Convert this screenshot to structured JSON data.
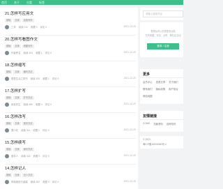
{
  "nav": [
    "首页",
    "关于",
    "分类",
    "标签",
    "归档",
    "其他"
  ],
  "articles": [
    {
      "title": "21.怎样写应用文",
      "tags": [
        "基础",
        "文体",
        "应用写作"
      ],
      "author": "三享",
      "views": "阅读 211",
      "likes": "收藏 0",
      "comments": "评论 0",
      "date": "2021-12-20"
    },
    {
      "title": "20.怎样写看图作文",
      "tags": [
        "基础",
        "文体",
        "看图写作"
      ],
      "author": "作者佚名",
      "views": "阅读 304",
      "likes": "收藏 1",
      "comments": "评论 0",
      "date": "2021-12-20"
    },
    {
      "title": "18.怎样缩写",
      "tags": [
        "基础",
        "文体",
        "缩写方法"
      ],
      "author": "很是生活之类书",
      "views": "阅读 320",
      "likes": "收藏 1",
      "comments": "评论 0",
      "date": "2021-12-20"
    },
    {
      "title": "17.怎样扩写",
      "tags": [
        "基础",
        "文体",
        "扩写方法"
      ],
      "author": "张老先生",
      "views": "阅读 289",
      "likes": "收藏 0",
      "comments": "评论 0",
      "date": "2021-12-20"
    },
    {
      "title": "16.怎样改写",
      "tags": [
        "基础",
        "文体",
        "改写方法"
      ],
      "author": "周小在",
      "views": "阅读 311",
      "likes": "收藏 1",
      "comments": "评论 0",
      "date": "2021-12-20"
    },
    {
      "title": "15.怎样续写",
      "tags": [
        "基础",
        "文体",
        "续写方法"
      ],
      "author": "基本人",
      "views": "阅读 318",
      "likes": "收藏 0",
      "comments": "评论 0",
      "date": "2021-12-20"
    },
    {
      "title": "14.怎样记人",
      "tags": [
        "基础",
        "文体",
        "记人方法"
      ],
      "author": "阿我她说与朋霖",
      "views": "阅读 302",
      "likes": "收藏 0",
      "comments": "评论 0",
      "date": "2021-12-20"
    }
  ],
  "search_placeholder": "请输入搜索内容",
  "login": {
    "line1": "登录后可以享受更多功能",
    "line2": "文章收藏、评论、点赞、等社区互动",
    "button": "登录 / 注册"
  },
  "more": {
    "title": "更多",
    "row1": [
      "会员中心",
      "发表文章",
      "关于我们"
    ],
    "row2": [
      "联系我们",
      "隐私政策",
      "用户协议"
    ],
    "row3": [
      "网站地图"
    ]
  },
  "friends": {
    "title": "友情链接",
    "links": [
      "CCMC",
      "文献资料",
      "百科知识"
    ]
  },
  "footer": {
    "line1": "© 2021",
    "line2": "粤ICP备18005380号-2"
  },
  "colors": {
    "accent": "#3cbf8a"
  }
}
